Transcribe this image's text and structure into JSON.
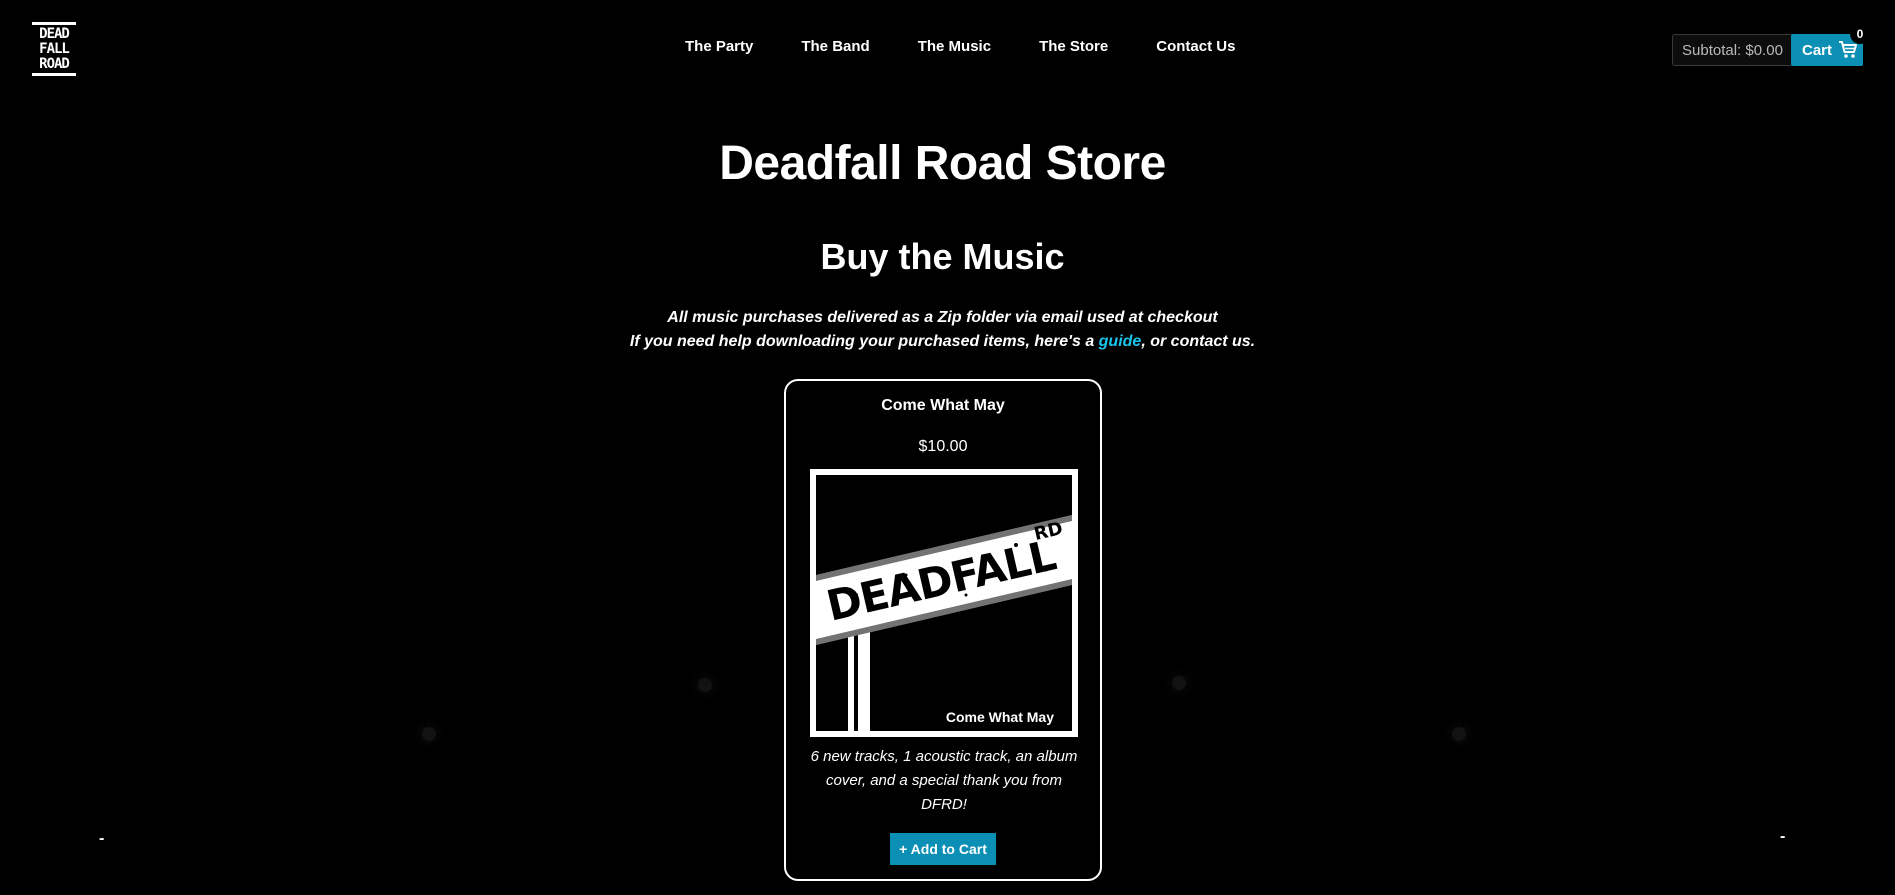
{
  "brand": {
    "logo_lines": [
      "DEAD",
      "FALL",
      "ROAD"
    ]
  },
  "nav": {
    "items": [
      "The Party",
      "The Band",
      "The Music",
      "The Store",
      "Contact Us"
    ]
  },
  "cart": {
    "subtotal": "Subtotal: $0.00",
    "label": "Cart",
    "count": "0",
    "icon": "shopping-cart-icon",
    "accent_color": "#0c8fb5"
  },
  "page": {
    "title": "Deadfall Road Store",
    "section_title": "Buy the Music",
    "note_line1": "All music purchases delivered as a Zip folder via email used at checkout",
    "note_line2_prefix": "If you need help downloading your purchased items, here's a ",
    "note_link": "guide",
    "note_line2_suffix": ", or contact us.",
    "link_color": "#19c4ea"
  },
  "product": {
    "name": "Come What May",
    "price": "$10.00",
    "cover_sign_text": "DEADFALL",
    "cover_sign_suffix": "RD",
    "cover_caption": "Come What May",
    "description": "6 new tracks, 1 acoustic track, an album cover, and a special thank you from DFRD!",
    "add_button": "+ Add to Cart"
  },
  "carousel": {
    "prev": "-",
    "next": "-"
  }
}
